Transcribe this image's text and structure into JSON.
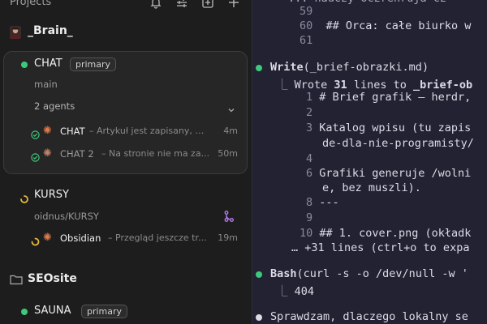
{
  "sidebar": {
    "title": "Projects",
    "header_icons": [
      "bell-icon",
      "sliders-icon",
      "new-window-icon",
      "plus-icon"
    ],
    "projects": [
      {
        "name": "_Brain_",
        "icon": "avatar-icon",
        "sessions": [
          {
            "name": "CHAT",
            "status": "active",
            "badge": "primary",
            "branch": "main",
            "agents_label": "2 agents",
            "agents": [
              {
                "name": "CHAT",
                "desc": "Artykuł jest zapisany, al...",
                "time": "4m",
                "status": "done"
              },
              {
                "name": "CHAT 2",
                "desc": "Na stronie nie ma za...",
                "time": "50m",
                "status": "done"
              }
            ]
          },
          {
            "name": "KURSY",
            "status": "running",
            "branch": "oidnus/KURSY",
            "agents": [
              {
                "name": "Obsidian",
                "desc": "Przegląd jeszcze tr...",
                "time": "19m",
                "status": "running"
              }
            ]
          }
        ]
      },
      {
        "name": "SEOsite",
        "icon": "folder-icon",
        "sessions": [
          {
            "name": "SAUNA",
            "status": "active",
            "badge": "primary"
          }
        ]
      }
    ]
  },
  "terminal": {
    "line_59": "59",
    "line_60_num": "60",
    "line_60_text": "## Orca: całe biurko w",
    "line_61": "61",
    "top_partial": "... nauczy oczrenruja cz",
    "write_cmd": "Write",
    "write_arg": "(_brief-obrazki.md)",
    "wrote_prefix": "Wrote ",
    "wrote_count": "31",
    "wrote_mid": " lines to ",
    "wrote_file": "_brief-ob",
    "l1_num": "1",
    "l1_text": "# Brief grafik – herdr,",
    "l2_num": "2",
    "l3_num": "3",
    "l3_text": "Katalog wpisu (tu zapis",
    "l3_cont": "de-dla-nie-programisty/",
    "l4_num": "4",
    "l5_num": "5",
    "l6_num": "6",
    "l6_text": "Grafiki generuje /wolni",
    "l6_cont": "e, bez muszli).",
    "l8_num": "8",
    "l8_text": "---",
    "l9_num": "9",
    "l10_num": "10",
    "l10_text": "## 1. cover.png (okładk",
    "more_lines": "… +31 lines (ctrl+o to expa",
    "bash_cmd": "Bash",
    "bash_arg": "(curl -s -o /dev/null -w '",
    "bash_result": "404",
    "last_line": "Sprawdzam, dlaczego lokalny se",
    "colors": {
      "success": "#3ec97a",
      "running": "#e8b93a",
      "branch": "#b57be8",
      "accent": "#e07a4a"
    }
  }
}
